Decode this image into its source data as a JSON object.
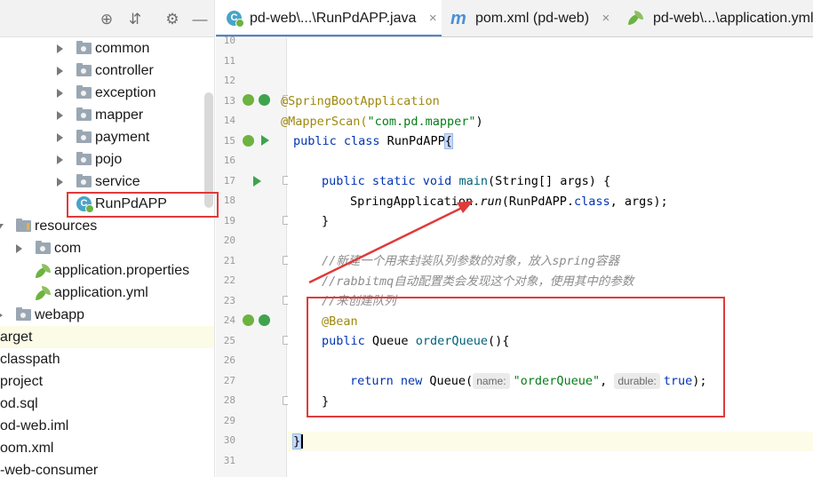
{
  "project_tree": {
    "rows": [
      {
        "label": "common",
        "icon": "folder-icon",
        "indent": 86,
        "caret": "right"
      },
      {
        "label": "controller",
        "icon": "folder-icon",
        "indent": 86,
        "caret": "right"
      },
      {
        "label": "exception",
        "icon": "folder-icon",
        "indent": 86,
        "caret": "right"
      },
      {
        "label": "mapper",
        "icon": "folder-icon",
        "indent": 86,
        "caret": "right"
      },
      {
        "label": "payment",
        "icon": "folder-icon",
        "indent": 86,
        "caret": "right"
      },
      {
        "label": "pojo",
        "icon": "folder-icon",
        "indent": 86,
        "caret": "right"
      },
      {
        "label": "service",
        "icon": "folder-icon",
        "indent": 86,
        "caret": "right"
      },
      {
        "label": "RunPdAPP",
        "icon": "spring-boot-class-icon",
        "indent": 86,
        "caret": "none",
        "state": "selected"
      },
      {
        "label": "resources",
        "icon": "resources-folder-icon",
        "indent": 18,
        "caret": "down"
      },
      {
        "label": "com",
        "icon": "folder-icon",
        "indent": 40,
        "caret": "right"
      },
      {
        "label": "application.properties",
        "icon": "spring-config-icon",
        "indent": 40,
        "caret": "none"
      },
      {
        "label": "application.yml",
        "icon": "spring-config-icon",
        "indent": 40,
        "caret": "none"
      },
      {
        "label": "webapp",
        "icon": "folder-icon",
        "indent": 18,
        "caret": "right"
      },
      {
        "label": "arget",
        "icon": "",
        "indent": 0,
        "caret": "none",
        "state": "highlight"
      },
      {
        "label": "classpath",
        "icon": "",
        "indent": 0,
        "caret": "none"
      },
      {
        "label": "project",
        "icon": "",
        "indent": 0,
        "caret": "none"
      },
      {
        "label": "od.sql",
        "icon": "",
        "indent": 0,
        "caret": "none"
      },
      {
        "label": "od-web.iml",
        "icon": "",
        "indent": 0,
        "caret": "none"
      },
      {
        "label": "oom.xml",
        "icon": "",
        "indent": 0,
        "caret": "none"
      },
      {
        "label": "-web-consumer",
        "icon": "",
        "indent": 0,
        "caret": "none"
      }
    ]
  },
  "toolbar": {
    "locate": "⊕",
    "collapse": "⇵",
    "settings": "⚙",
    "hide": "—"
  },
  "tabs": [
    {
      "label": "pd-web\\...\\RunPdAPP.java",
      "close": "×",
      "active": true,
      "icon": "spring-boot-class-icon"
    },
    {
      "label": "pom.xml (pd-web)",
      "close": "×",
      "active": false,
      "icon": "maven-icon",
      "glyph": "m"
    },
    {
      "label": "pd-web\\...\\application.yml",
      "close": "",
      "active": false,
      "icon": "spring-config-icon"
    }
  ],
  "editor": {
    "line_numbers": [
      "10",
      "11",
      "12",
      "13",
      "14",
      "15",
      "16",
      "17",
      "18",
      "19",
      "20",
      "21",
      "22",
      "23",
      "24",
      "25",
      "26",
      "27",
      "28",
      "29",
      "30",
      "31"
    ],
    "lines": {
      "l13": "@SpringBootApplication",
      "l14_ann": "@MapperScan(",
      "l14_str": "\"com.pd.mapper\"",
      "l14_end": ")",
      "l15_kw": "public class ",
      "l15_name": "RunPdAPP",
      "l15_brace": "{",
      "l17_kw": "public static void ",
      "l17_fn": "main",
      "l17_rest": "(String[] args) {",
      "l18_a": "SpringApplication.",
      "l18_run": "run",
      "l18_b": "(RunPdAPP.",
      "l18_class": "class",
      "l18_c": ", args);",
      "l19": "}",
      "l21": "//新建一个用来封装队列参数的对象，放入spring容器",
      "l22": "//rabbitmq自动配置类会发现这个对象，使用其中的参数",
      "l23": "//来创建队列",
      "l24": "@Bean",
      "l25_kw": "public ",
      "l25_type": "Queue ",
      "l25_fn": "orderQueue",
      "l25_rest": "(){",
      "l27_kw": "return new ",
      "l27_type": "Queue(",
      "l27_hint1": "name:",
      "l27_str": "\"orderQueue\"",
      "l27_comma": ", ",
      "l27_hint2": "durable:",
      "l27_true": "true",
      "l27_end": ");",
      "l28": "}",
      "l30": "}"
    }
  },
  "colors": {
    "annotation_red": "#e03a3a",
    "keyword": "#0033b3",
    "annotation": "#9e880d",
    "string": "#067d17",
    "comment": "#8c8c8c",
    "method": "#00627a"
  }
}
